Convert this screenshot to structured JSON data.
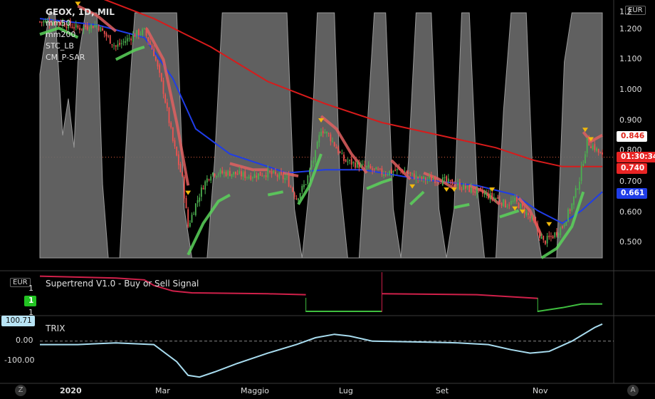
{
  "header": {
    "title": "GEOX, 1D, MIL",
    "indicators": [
      "mm50",
      "mm200",
      "STC_LB",
      "CM_P-SAR"
    ]
  },
  "currency": "EUR",
  "price_axis": [
    "1.200",
    "1.100",
    "1.000",
    "0.900",
    "0.800",
    "0.700",
    "0.600",
    "0.500"
  ],
  "price_axis_top_partial": "1.2",
  "badges": {
    "upper": "0.846",
    "countdown": "01:30:34",
    "last": "0.740",
    "ma50": "0.661"
  },
  "supertrend_panel": {
    "title": "Supertrend V1.0 - Buy or Sell Signal",
    "currency": "EUR",
    "axis_labels": [
      "1",
      "1",
      "1"
    ],
    "signal_badge": "1"
  },
  "trix_panel": {
    "title": "TRIX",
    "badge": "100.71",
    "axis_labels": [
      "0.00",
      "-100.00"
    ]
  },
  "x_axis": [
    "2020",
    "Mar",
    "Maggio",
    "Lug",
    "Set",
    "Nov"
  ],
  "footer": {
    "left_button": "Z",
    "right_button": "A"
  },
  "colors": {
    "background": "#000000",
    "up": "#4caf50",
    "down": "#ef5350",
    "ma50": "#1f3de8",
    "ma200": "#d81b1b",
    "stc": "#6a6a6a",
    "sar_bull": "#5bd45b",
    "sar_bear": "#e06060",
    "trix": "#a8dcef",
    "supertrend_bull": "#3fbf3f",
    "supertrend_bear": "#d0204a",
    "triangle": "#f2b90b"
  },
  "chart_data": [
    {
      "type": "candlestick",
      "title": "GEOX, 1D, MIL",
      "ylim": [
        0.45,
        1.26
      ],
      "x_categories": [
        "2020",
        "Mar",
        "Maggio",
        "Lug",
        "Set",
        "Nov"
      ],
      "close_path": [
        [
          0,
          1.2
        ],
        [
          10,
          1.2
        ],
        [
          20,
          1.18
        ],
        [
          30,
          1.19
        ],
        [
          40,
          1.12
        ],
        [
          50,
          1.16
        ],
        [
          55,
          1.17
        ],
        [
          60,
          1.1
        ],
        [
          65,
          0.98
        ],
        [
          70,
          0.82
        ],
        [
          75,
          0.7
        ],
        [
          78,
          0.55
        ],
        [
          82,
          0.62
        ],
        [
          86,
          0.68
        ],
        [
          90,
          0.72
        ],
        [
          100,
          0.72
        ],
        [
          110,
          0.71
        ],
        [
          120,
          0.72
        ],
        [
          130,
          0.7
        ],
        [
          135,
          0.64
        ],
        [
          140,
          0.69
        ],
        [
          145,
          0.78
        ],
        [
          148,
          0.86
        ],
        [
          152,
          0.84
        ],
        [
          156,
          0.8
        ],
        [
          160,
          0.76
        ],
        [
          170,
          0.74
        ],
        [
          180,
          0.72
        ],
        [
          190,
          0.73
        ],
        [
          200,
          0.7
        ],
        [
          210,
          0.7
        ],
        [
          220,
          0.68
        ],
        [
          230,
          0.66
        ],
        [
          240,
          0.64
        ],
        [
          245,
          0.62
        ],
        [
          250,
          0.63
        ],
        [
          255,
          0.6
        ],
        [
          260,
          0.56
        ],
        [
          265,
          0.5
        ],
        [
          270,
          0.52
        ],
        [
          275,
          0.55
        ],
        [
          280,
          0.62
        ],
        [
          284,
          0.7
        ],
        [
          288,
          0.82
        ],
        [
          292,
          0.8
        ],
        [
          296,
          0.77
        ]
      ],
      "ma50": [
        [
          0,
          1.21
        ],
        [
          30,
          1.19
        ],
        [
          55,
          1.15
        ],
        [
          70,
          1.02
        ],
        [
          82,
          0.86
        ],
        [
          100,
          0.78
        ],
        [
          130,
          0.72
        ],
        [
          150,
          0.73
        ],
        [
          170,
          0.73
        ],
        [
          200,
          0.7
        ],
        [
          230,
          0.68
        ],
        [
          250,
          0.65
        ],
        [
          262,
          0.6
        ],
        [
          275,
          0.56
        ],
        [
          285,
          0.6
        ],
        [
          296,
          0.66
        ]
      ],
      "ma200": [
        [
          0,
          1.3
        ],
        [
          30,
          1.28
        ],
        [
          60,
          1.21
        ],
        [
          90,
          1.12
        ],
        [
          120,
          1.01
        ],
        [
          150,
          0.94
        ],
        [
          180,
          0.88
        ],
        [
          210,
          0.84
        ],
        [
          240,
          0.8
        ],
        [
          260,
          0.76
        ],
        [
          275,
          0.74
        ],
        [
          285,
          0.74
        ],
        [
          296,
          0.74
        ]
      ],
      "sar_segments": [
        {
          "trend": "bull",
          "points": [
            [
              0,
              1.16
            ],
            [
              10,
              1.18
            ],
            [
              20,
              1.15
            ]
          ]
        },
        {
          "trend": "bear",
          "points": [
            [
              20,
              1.25
            ],
            [
              30,
              1.22
            ],
            [
              40,
              1.17
            ]
          ]
        },
        {
          "trend": "bull",
          "points": [
            [
              40,
              1.08
            ],
            [
              50,
              1.11
            ],
            [
              55,
              1.12
            ]
          ]
        },
        {
          "trend": "bear",
          "points": [
            [
              56,
              1.18
            ],
            [
              65,
              1.08
            ],
            [
              72,
              0.88
            ],
            [
              78,
              0.68
            ]
          ]
        },
        {
          "trend": "bull",
          "points": [
            [
              78,
              0.46
            ],
            [
              86,
              0.56
            ],
            [
              94,
              0.63
            ],
            [
              100,
              0.65
            ]
          ]
        },
        {
          "trend": "bear",
          "points": [
            [
              100,
              0.75
            ],
            [
              112,
              0.73
            ],
            [
              120,
              0.73
            ]
          ]
        },
        {
          "trend": "bull",
          "points": [
            [
              120,
              0.65
            ],
            [
              128,
              0.66
            ]
          ]
        },
        {
          "trend": "bear",
          "points": [
            [
              128,
              0.72
            ],
            [
              136,
              0.71
            ]
          ]
        },
        {
          "trend": "bull",
          "points": [
            [
              136,
              0.62
            ],
            [
              142,
              0.68
            ],
            [
              148,
              0.78
            ]
          ]
        },
        {
          "trend": "bear",
          "points": [
            [
              148,
              0.9
            ],
            [
              156,
              0.86
            ],
            [
              164,
              0.78
            ],
            [
              172,
              0.72
            ]
          ]
        },
        {
          "trend": "bull",
          "points": [
            [
              172,
              0.67
            ],
            [
              180,
              0.69
            ],
            [
              185,
              0.7
            ]
          ]
        },
        {
          "trend": "bear",
          "points": [
            [
              185,
              0.76
            ],
            [
              195,
              0.7
            ]
          ]
        },
        {
          "trend": "bull",
          "points": [
            [
              195,
              0.62
            ],
            [
              202,
              0.66
            ]
          ]
        },
        {
          "trend": "bear",
          "points": [
            [
              202,
              0.72
            ],
            [
              210,
              0.7
            ],
            [
              218,
              0.67
            ]
          ]
        },
        {
          "trend": "bull",
          "points": [
            [
              218,
              0.61
            ],
            [
              226,
              0.62
            ]
          ]
        },
        {
          "trend": "bear",
          "points": [
            [
              226,
              0.68
            ],
            [
              234,
              0.66
            ],
            [
              242,
              0.62
            ]
          ]
        },
        {
          "trend": "bull",
          "points": [
            [
              242,
              0.58
            ],
            [
              252,
              0.6
            ]
          ]
        },
        {
          "trend": "bear",
          "points": [
            [
              252,
              0.64
            ],
            [
              258,
              0.6
            ],
            [
              264,
              0.52
            ]
          ]
        },
        {
          "trend": "bull",
          "points": [
            [
              264,
              0.45
            ],
            [
              272,
              0.48
            ],
            [
              280,
              0.55
            ],
            [
              286,
              0.66
            ]
          ]
        },
        {
          "trend": "bear",
          "points": [
            [
              286,
              0.85
            ],
            [
              290,
              0.82
            ],
            [
              296,
              0.84
            ]
          ]
        }
      ],
      "sell_signals": [
        [
          20,
          1.25
        ],
        [
          78,
          0.65
        ],
        [
          148,
          0.88
        ],
        [
          196,
          0.67
        ],
        [
          214,
          0.66
        ],
        [
          218,
          0.66
        ],
        [
          238,
          0.66
        ],
        [
          250,
          0.6
        ],
        [
          254,
          0.59
        ],
        [
          268,
          0.55
        ],
        [
          287,
          0.85
        ],
        [
          290,
          0.82
        ]
      ]
    },
    {
      "type": "area",
      "name": "STC_LB",
      "ylim": [
        0,
        100
      ],
      "points": [
        [
          0,
          75
        ],
        [
          5,
          100
        ],
        [
          8,
          100
        ],
        [
          12,
          50
        ],
        [
          15,
          65
        ],
        [
          18,
          45
        ],
        [
          20,
          80
        ],
        [
          24,
          100
        ],
        [
          30,
          100
        ],
        [
          33,
          30
        ],
        [
          36,
          0
        ],
        [
          42,
          0
        ],
        [
          46,
          55
        ],
        [
          50,
          100
        ],
        [
          72,
          100
        ],
        [
          76,
          20
        ],
        [
          80,
          0
        ],
        [
          88,
          0
        ],
        [
          92,
          40
        ],
        [
          96,
          100
        ],
        [
          130,
          100
        ],
        [
          134,
          20
        ],
        [
          138,
          0
        ],
        [
          142,
          30
        ],
        [
          146,
          100
        ],
        [
          155,
          100
        ],
        [
          158,
          30
        ],
        [
          162,
          0
        ],
        [
          168,
          0
        ],
        [
          172,
          50
        ],
        [
          176,
          100
        ],
        [
          182,
          100
        ],
        [
          186,
          20
        ],
        [
          190,
          0
        ],
        [
          194,
          40
        ],
        [
          198,
          100
        ],
        [
          206,
          100
        ],
        [
          210,
          20
        ],
        [
          214,
          0
        ],
        [
          218,
          20
        ],
        [
          222,
          100
        ],
        [
          226,
          100
        ],
        [
          230,
          30
        ],
        [
          234,
          0
        ],
        [
          240,
          0
        ],
        [
          244,
          60
        ],
        [
          248,
          100
        ],
        [
          256,
          100
        ],
        [
          260,
          20
        ],
        [
          264,
          0
        ],
        [
          272,
          0
        ],
        [
          276,
          80
        ],
        [
          280,
          100
        ],
        [
          296,
          100
        ]
      ]
    },
    {
      "type": "line",
      "name": "Supertrend V1.0 - Buy or Sell Signal",
      "segments": [
        {
          "trend": "bear",
          "points": [
            [
              0,
              1.9
            ],
            [
              40,
              1.8
            ],
            [
              55,
              1.7
            ],
            [
              60,
              1.4
            ],
            [
              70,
              1.1
            ],
            [
              80,
              1.0
            ],
            [
              120,
              0.95
            ],
            [
              140,
              0.9
            ]
          ]
        },
        {
          "trend": "bull",
          "points": [
            [
              140,
              0.0
            ],
            [
              180,
              0.0
            ]
          ]
        },
        {
          "trend": "bear",
          "points": [
            [
              180,
              0.95
            ],
            [
              230,
              0.9
            ],
            [
              262,
              0.7
            ]
          ]
        },
        {
          "trend": "bull",
          "points": [
            [
              262,
              0.0
            ],
            [
              275,
              0.2
            ],
            [
              285,
              0.4
            ],
            [
              296,
              0.4
            ]
          ]
        }
      ]
    },
    {
      "type": "line",
      "name": "TRIX",
      "ylim": [
        -230,
        120
      ],
      "points": [
        [
          0,
          -20
        ],
        [
          20,
          -20
        ],
        [
          40,
          -10
        ],
        [
          60,
          -20
        ],
        [
          72,
          -120
        ],
        [
          78,
          -200
        ],
        [
          84,
          -210
        ],
        [
          92,
          -180
        ],
        [
          104,
          -130
        ],
        [
          120,
          -70
        ],
        [
          135,
          -20
        ],
        [
          145,
          20
        ],
        [
          155,
          40
        ],
        [
          163,
          30
        ],
        [
          175,
          0
        ],
        [
          200,
          -5
        ],
        [
          220,
          -10
        ],
        [
          236,
          -20
        ],
        [
          248,
          -50
        ],
        [
          258,
          -70
        ],
        [
          268,
          -60
        ],
        [
          280,
          0
        ],
        [
          292,
          80
        ],
        [
          296,
          100
        ]
      ]
    }
  ]
}
